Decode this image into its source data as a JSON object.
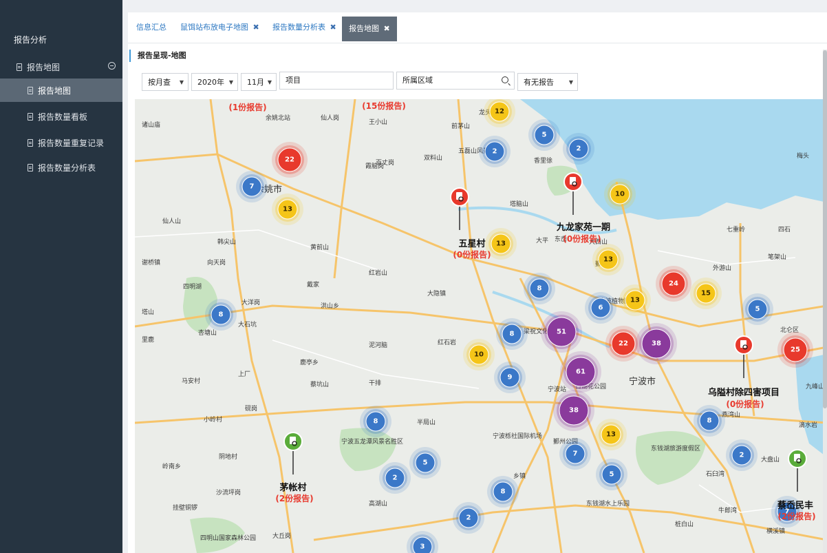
{
  "sidebar": {
    "title": "报告分析",
    "group_label": "报告地图",
    "items": [
      {
        "label": "报告地图"
      },
      {
        "label": "报告数量看板"
      },
      {
        "label": "报告数量重复记录"
      },
      {
        "label": "报告数量分析表"
      }
    ]
  },
  "tabs": [
    {
      "label": "信息汇总"
    },
    {
      "label": "鼠饵站布放电子地图"
    },
    {
      "label": "报告数量分析表"
    },
    {
      "label": "报告地图"
    }
  ],
  "tab_close": "✖",
  "breadcrumb": "报告呈现-地图",
  "filters": {
    "mode": "按月查",
    "year": "2020年",
    "month": "11月",
    "project_placeholder": "项目",
    "region_placeholder": "所属区域",
    "has_report": "有无报告"
  },
  "map": {
    "places": [
      {
        "name": "诸山庙"
      },
      {
        "name": "余姚北站"
      },
      {
        "name": "仙人岗"
      },
      {
        "name": "王小山"
      },
      {
        "name": "前茅山"
      },
      {
        "name": "百丈岗"
      },
      {
        "name": "霞脑岗"
      },
      {
        "name": "双料山"
      },
      {
        "name": "五磊山风景区"
      },
      {
        "name": "香里徐"
      },
      {
        "name": "余姚市"
      },
      {
        "name": "塔脑山"
      },
      {
        "name": "仙人山"
      },
      {
        "name": "韩尖山"
      },
      {
        "name": "黄前山"
      },
      {
        "name": "东岙"
      },
      {
        "name": "大西山"
      },
      {
        "name": "谢桥镇"
      },
      {
        "name": "向天岗"
      },
      {
        "name": "红岩山"
      },
      {
        "name": "四明湖"
      },
      {
        "name": "大洋岗"
      },
      {
        "name": "戴家"
      },
      {
        "name": "大隐镇"
      },
      {
        "name": "洪山乡"
      },
      {
        "name": "塔山"
      },
      {
        "name": "大石坑"
      },
      {
        "name": "杏塘山"
      },
      {
        "name": "里鹿"
      },
      {
        "name": "泥河脑"
      },
      {
        "name": "红石岩"
      },
      {
        "name": "梁祝文化公园"
      },
      {
        "name": "宁波植物园"
      },
      {
        "name": "外游山"
      },
      {
        "name": "笔架山"
      },
      {
        "name": "鹿亭乡"
      },
      {
        "name": "马安村"
      },
      {
        "name": "上厂"
      },
      {
        "name": "蔡坑山"
      },
      {
        "name": "干排"
      },
      {
        "name": "宁波市"
      },
      {
        "name": "宁波站"
      },
      {
        "name": "日湖花公园"
      },
      {
        "name": "九峰山"
      },
      {
        "name": "小岭村"
      },
      {
        "name": "砚岗"
      },
      {
        "name": "半局山"
      },
      {
        "name": "燕湾山"
      },
      {
        "name": "滴水岩"
      },
      {
        "name": "宁波五龙潭风景名胜区"
      },
      {
        "name": "宁波栎社国际机场"
      },
      {
        "name": "鄞州公园"
      },
      {
        "name": "东钱湖旅游度假区"
      },
      {
        "name": "岭南乡"
      },
      {
        "name": "阴地村"
      },
      {
        "name": "沙流坪岗"
      },
      {
        "name": "高湖山"
      },
      {
        "name": "乡镇"
      },
      {
        "name": "东钱湖水上乐园"
      },
      {
        "name": "挂壁铜锣"
      },
      {
        "name": "四明山国家森林公园"
      },
      {
        "name": "大丘岗"
      },
      {
        "name": "大盘山"
      },
      {
        "name": "石臼湾"
      },
      {
        "name": "桩白山"
      },
      {
        "name": "横溪镇"
      },
      {
        "name": "牛郎湾"
      },
      {
        "name": "七重岭"
      },
      {
        "name": "四石"
      },
      {
        "name": "梅头"
      },
      {
        "name": "北仑区"
      },
      {
        "name": "大平"
      },
      {
        "name": "鄞州区"
      },
      {
        "name": "龙头"
      }
    ],
    "clusters": [
      {
        "value": "12",
        "level": "yellow"
      },
      {
        "value": "22",
        "level": "red"
      },
      {
        "value": "5",
        "level": "blue"
      },
      {
        "value": "2",
        "level": "blue"
      },
      {
        "value": "2",
        "level": "blue"
      },
      {
        "value": "7",
        "level": "blue"
      },
      {
        "value": "13",
        "level": "yellow"
      },
      {
        "value": "10",
        "level": "yellow"
      },
      {
        "value": "13",
        "level": "yellow"
      },
      {
        "value": "13",
        "level": "yellow"
      },
      {
        "value": "8",
        "level": "blue"
      },
      {
        "value": "24",
        "level": "red"
      },
      {
        "value": "15",
        "level": "yellow"
      },
      {
        "value": "6",
        "level": "blue"
      },
      {
        "value": "13",
        "level": "yellow"
      },
      {
        "value": "8",
        "level": "blue"
      },
      {
        "value": "5",
        "level": "blue"
      },
      {
        "value": "51",
        "level": "purple"
      },
      {
        "value": "22",
        "level": "red"
      },
      {
        "value": "38",
        "level": "purple"
      },
      {
        "value": "25",
        "level": "red"
      },
      {
        "value": "8",
        "level": "blue"
      },
      {
        "value": "10",
        "level": "yellow"
      },
      {
        "value": "61",
        "level": "purple"
      },
      {
        "value": "9",
        "level": "blue"
      },
      {
        "value": "38",
        "level": "purple"
      },
      {
        "value": "8",
        "level": "blue"
      },
      {
        "value": "13",
        "level": "yellow"
      },
      {
        "value": "8",
        "level": "blue"
      },
      {
        "value": "7",
        "level": "blue"
      },
      {
        "value": "2",
        "level": "blue"
      },
      {
        "value": "5",
        "level": "blue"
      },
      {
        "value": "2",
        "level": "blue"
      },
      {
        "value": "5",
        "level": "blue"
      },
      {
        "value": "8",
        "level": "blue"
      },
      {
        "value": "2",
        "level": "blue"
      },
      {
        "value": "7",
        "level": "blue"
      },
      {
        "value": "3",
        "level": "blue"
      }
    ],
    "markers": [
      {
        "title": "五星村",
        "count": "(0份报告)",
        "color": "red"
      },
      {
        "title": "九龙家苑一期",
        "count": "(0份报告)",
        "color": "red"
      },
      {
        "title": "乌隘村除四害项目",
        "count": "(0份报告)",
        "color": "red"
      },
      {
        "title": "茅帐村",
        "count": "(2份报告)",
        "color": "green"
      },
      {
        "title": "蔡岙民丰",
        "count": "(2份报告)",
        "color": "green"
      }
    ],
    "partial_labels": [
      {
        "text": "(1份报告)"
      },
      {
        "text": "(15份报告)"
      }
    ],
    "colors": {
      "blue": "#3b78c8",
      "yellow": "#f5c518",
      "red": "#e8392c",
      "purple": "#8a3a9c",
      "green": "#5aac3a"
    }
  }
}
